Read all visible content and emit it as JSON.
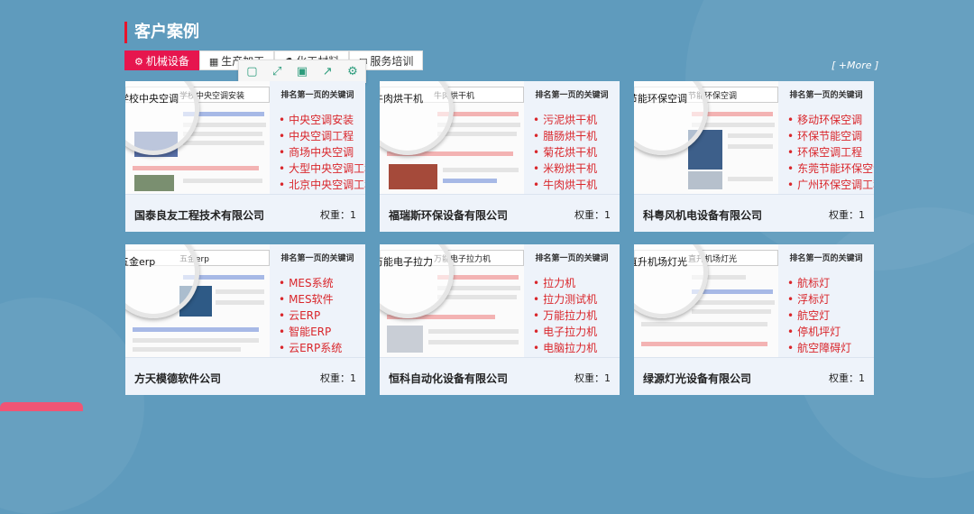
{
  "section": {
    "title": "客户案例"
  },
  "tabs": [
    {
      "label": "机械设备",
      "icon": "gear-icon"
    },
    {
      "label": "生产加工",
      "icon": "building-icon"
    },
    {
      "label": "化工材料",
      "icon": "flask-icon"
    },
    {
      "label": "服务培训",
      "icon": "chat-icon"
    }
  ],
  "toolbar": {
    "icons": [
      "frame-icon",
      "expand-icon",
      "save-icon",
      "share-icon",
      "settings-icon"
    ]
  },
  "more_label": "[ +More ]",
  "keyword_header": "排名第一页的关键词",
  "cards": [
    {
      "search_query": "学校中央空调安装",
      "magnified": "学校中央空调",
      "keywords": [
        "中央空调安装",
        "中央空调工程",
        "商场中央空调",
        "大型中央空调工程",
        "北京中央空调工程"
      ],
      "company": "国泰良友工程技术有限公司",
      "weight": "权重：1"
    },
    {
      "search_query": "牛肉烘干机",
      "magnified": "牛肉烘干机",
      "keywords": [
        "污泥烘干机",
        "腊肠烘干机",
        "菊花烘干机",
        "米粉烘干机",
        "牛肉烘干机"
      ],
      "company": "福瑞斯环保设备有限公司",
      "weight": "权重：1"
    },
    {
      "search_query": "节能环保空调",
      "magnified": "节能环保空调",
      "keywords": [
        "移动环保空调",
        "环保节能空调",
        "环保空调工程",
        "东莞节能环保空调",
        "广州环保空调工程"
      ],
      "company": "科粤风机电设备有限公司",
      "weight": "权重：1"
    },
    {
      "search_query": "五金erp",
      "magnified": "五金erp",
      "keywords": [
        "MES系统",
        "MES软件",
        "云ERP",
        "智能ERP",
        "云ERP系统"
      ],
      "company": "方天模德软件公司",
      "weight": "权重：1"
    },
    {
      "search_query": "万能电子拉力机",
      "magnified": "万能电子拉力",
      "keywords": [
        "拉力机",
        "拉力测试机",
        "万能拉力机",
        "电子拉力机",
        "电脑拉力机"
      ],
      "company": "恒科自动化设备有限公司",
      "weight": "权重：1"
    },
    {
      "search_query": "直升机场灯光",
      "magnified": "直升机场灯光",
      "keywords": [
        "航标灯",
        "浮标灯",
        "航空灯",
        "停机坪灯",
        "航空障碍灯"
      ],
      "company": "绿源灯光设备有限公司",
      "weight": "权重：1"
    }
  ]
}
